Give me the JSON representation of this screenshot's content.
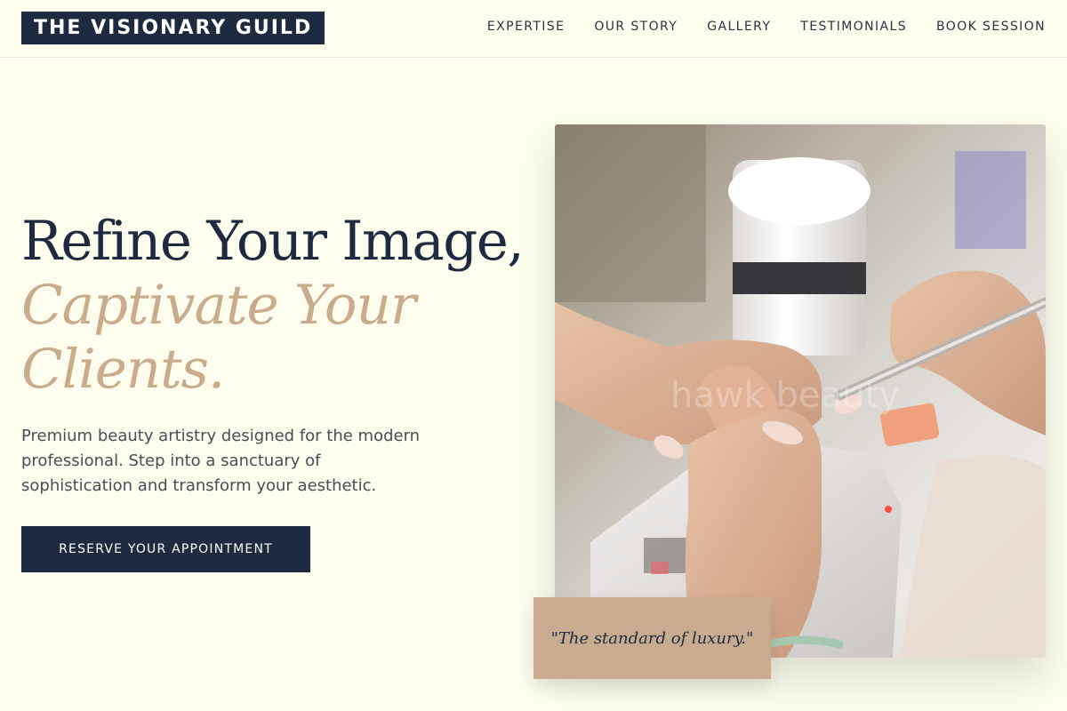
{
  "header": {
    "logo": "THE VISIONARY GUILD",
    "nav": [
      "EXPERTISE",
      "OUR STORY",
      "GALLERY",
      "TESTIMONIALS",
      "BOOK SESSION"
    ]
  },
  "hero": {
    "headline_line1": "Refine Your Image,",
    "headline_line2": "Captivate Your Clients.",
    "subtext": "Premium beauty artistry designed for the modern professional. Step into a sanctuary of sophistication and transform your aesthetic.",
    "cta_label": "RESERVE YOUR APPOINTMENT",
    "image_watermark": "hawk beauty",
    "quote": "\"The standard of luxury.\""
  },
  "colors": {
    "background": "#fdfdee",
    "navy": "#1e2a3f",
    "accent_tan": "#c9ab8d"
  }
}
